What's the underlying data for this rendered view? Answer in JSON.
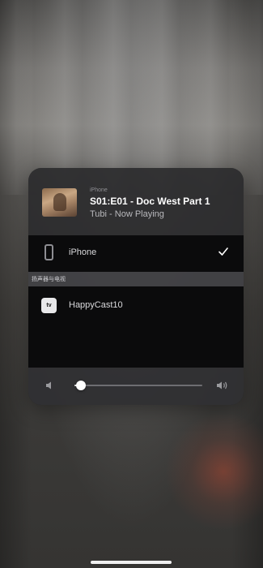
{
  "now_playing": {
    "source": "iPhone",
    "title": "S01:E01 - Doc West Part 1",
    "subtitle": "Tubi - Now Playing"
  },
  "devices": {
    "current": {
      "label": "iPhone",
      "selected": true,
      "icon": "iphone-icon"
    },
    "section_header": "扬声器与电视",
    "cast": {
      "label": "HappyCast10",
      "icon": "apple-tv-icon"
    }
  },
  "volume": {
    "level": 0.05
  },
  "colors": {
    "panel": "#141416",
    "row": "#0b0b0c",
    "text": "#d9d9dc"
  }
}
